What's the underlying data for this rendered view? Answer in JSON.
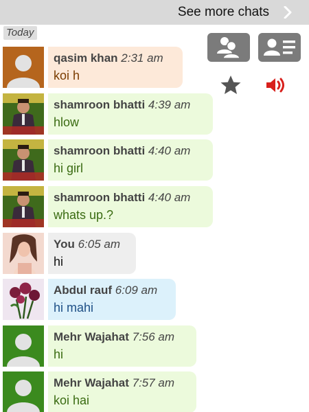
{
  "header": {
    "see_more": "See more chats"
  },
  "day_label": "Today",
  "actions": {
    "groups_icon": "group-chat-icon",
    "profile_icon": "profile-card-icon",
    "favorite_icon": "star-icon",
    "sound_icon": "speaker-icon"
  },
  "colors": {
    "top_bar": "#d9d9d9",
    "bubble_peach": "#fde9d9",
    "bubble_green": "#ecfadc",
    "bubble_self": "#eeeeee",
    "bubble_blue": "#dcf1fb",
    "text_brown": "#7a3c00",
    "text_green": "#3a6b12",
    "text_self": "#111111",
    "text_blue": "#1d4f86",
    "speaker_red": "#d8201c"
  },
  "messages": [
    {
      "name": "qasim khan",
      "time": "2:31 am",
      "text": "koi h",
      "avatar": "default-avatar"
    },
    {
      "name": "shamroon bhatti",
      "time": "4:39 am",
      "text": "hlow",
      "avatar": "photo-avatar"
    },
    {
      "name": "shamroon bhatti",
      "time": "4:40 am",
      "text": "hi girl",
      "avatar": "photo-avatar"
    },
    {
      "name": "shamroon bhatti",
      "time": "4:40 am",
      "text": "whats up.?",
      "avatar": "photo-avatar"
    },
    {
      "name": "You",
      "time": "6:05 am",
      "text": "hi",
      "avatar": "photo-avatar"
    },
    {
      "name": "Abdul rauf",
      "time": "6:09 am",
      "text": "hi mahi",
      "avatar": "roses-avatar"
    },
    {
      "name": "Mehr Wajahat",
      "time": "7:56 am",
      "text": "hi",
      "avatar": "default-avatar"
    },
    {
      "name": "Mehr Wajahat",
      "time": "7:57 am",
      "text": "koi hai",
      "avatar": "default-avatar"
    }
  ]
}
